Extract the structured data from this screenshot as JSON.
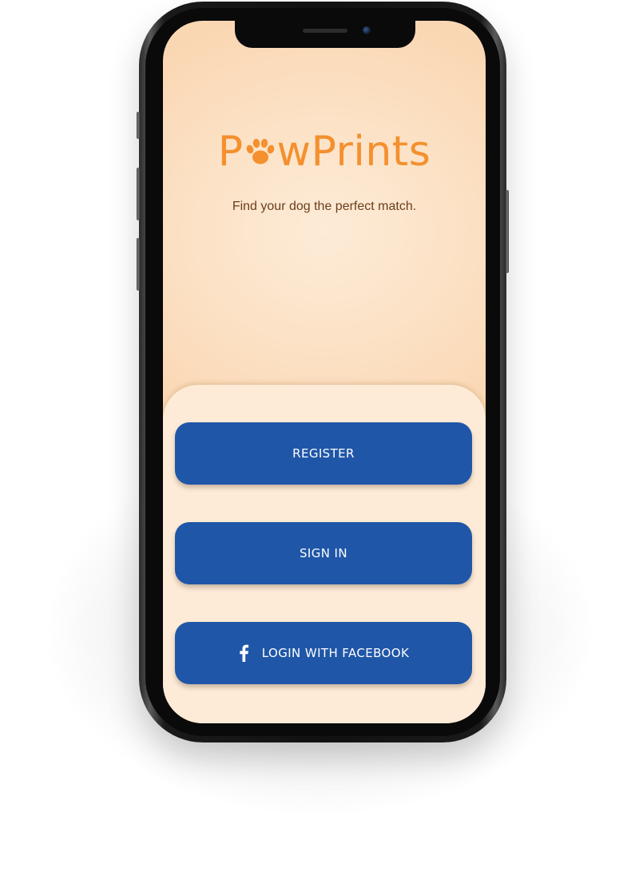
{
  "app": {
    "logo_text_before": "P",
    "logo_text_after": "wPrints",
    "tagline": "Find your dog the perfect match."
  },
  "actions": {
    "register_label": "REGISTER",
    "sign_in_label": "SIGN IN",
    "facebook_label": "LOGIN WITH FACEBOOK"
  },
  "icons": {
    "logo_paw": "paw-icon",
    "facebook": "facebook-icon"
  },
  "colors": {
    "brand_orange": "#f4902e",
    "tagline_brown": "#6b3e1b",
    "button_blue": "#1f56a8",
    "background_peach": "#fce3c8"
  }
}
